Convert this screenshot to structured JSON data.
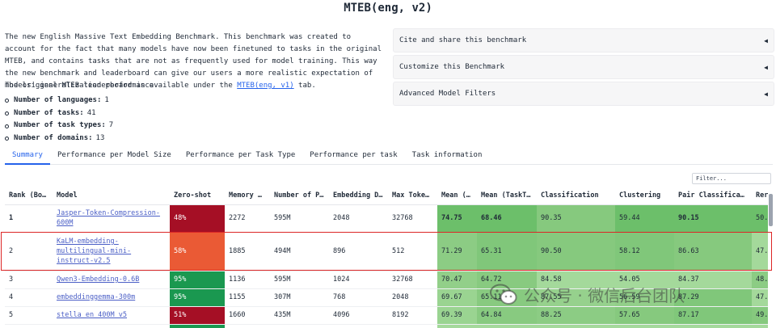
{
  "header": {
    "title": "MTEB(eng, v2)"
  },
  "intro": {
    "text": "The new English Massive Text Embedding Benchmark. This benchmark was created to account for the fact that many models have now been finetuned to tasks in the original MTEB, and contains tasks that are not as frequently used for model training. This way the new benchmark and leaderboard can give our users a more realistic expectation of models' generalization performance.",
    "orig_prefix": "The original MTEB leaderboard is available under the ",
    "orig_link": "MTEB(eng, v1)",
    "orig_suffix": " tab."
  },
  "stats": [
    {
      "label": "Number of languages:",
      "value": "1"
    },
    {
      "label": "Number of tasks:",
      "value": "41"
    },
    {
      "label": "Number of task types:",
      "value": "7"
    },
    {
      "label": "Number of domains:",
      "value": "13"
    }
  ],
  "accordions": [
    {
      "label": "Cite and share this benchmark",
      "arrow": "◀"
    },
    {
      "label": "Customize this Benchmark",
      "arrow": "◀"
    },
    {
      "label": "Advanced Model Filters",
      "arrow": "◀"
    }
  ],
  "tabs": [
    {
      "label": "Summary",
      "active": true
    },
    {
      "label": "Performance per Model Size"
    },
    {
      "label": "Performance per Task Type"
    },
    {
      "label": "Performance per task"
    },
    {
      "label": "Task information"
    }
  ],
  "filter": {
    "placeholder": "Filter..."
  },
  "table": {
    "headers": [
      "Rank (Bor…",
      "Model",
      "Zero-shot",
      "Memory U…",
      "Number of P…",
      "Embedding D…",
      "Max Tokens",
      "Mean (T…",
      "Mean (TaskT…",
      "Classification",
      "Clustering",
      "Pair Classificat…",
      "Rer"
    ],
    "rows": [
      {
        "rank": "1",
        "model": "Jasper-Token-Compression-600M",
        "zero_shot": "48%",
        "zs_color": "#a50f25",
        "memory": "2272",
        "params": "595M",
        "dim": "2048",
        "max_tokens": "32768",
        "mean_task": "74.75",
        "mean_type": "68.46",
        "classification": "90.35",
        "clustering": "59.44",
        "pair": "90.15",
        "rer": "50.",
        "bold": true
      },
      {
        "rank": "2",
        "model": "KaLM-embedding-multilingual-mini-instruct-v2.5",
        "zero_shot": "58%",
        "zs_color": "#ea5a35",
        "memory": "1885",
        "params": "494M",
        "dim": "896",
        "max_tokens": "512",
        "mean_task": "71.29",
        "mean_type": "65.31",
        "classification": "90.50",
        "clustering": "58.12",
        "pair": "86.63",
        "rer": "47."
      },
      {
        "rank": "3",
        "model": "Qwen3-Embedding-0.6B",
        "zero_shot": "95%",
        "zs_color": "#1a9850",
        "memory": "1136",
        "params": "595M",
        "dim": "1024",
        "max_tokens": "32768",
        "mean_task": "70.47",
        "mean_type": "64.72",
        "classification": "84.58",
        "clustering": "54.05",
        "pair": "84.37",
        "rer": "48."
      },
      {
        "rank": "4",
        "model": "embeddinggemma-300m",
        "zero_shot": "95%",
        "zs_color": "#1a9850",
        "memory": "1155",
        "params": "307M",
        "dim": "768",
        "max_tokens": "2048",
        "mean_task": "69.67",
        "mean_type": "65.11",
        "classification": "87.55",
        "clustering": "56.59",
        "pair": "87.29",
        "rer": "47."
      },
      {
        "rank": "5",
        "model": "stella_en_400M_v5",
        "zero_shot": "51%",
        "zs_color": "#a50f25",
        "memory": "1660",
        "params": "435M",
        "dim": "4096",
        "max_tokens": "8192",
        "mean_task": "69.39",
        "mean_type": "64.84",
        "classification": "88.25",
        "clustering": "57.65",
        "pair": "87.17",
        "rer": "49."
      }
    ]
  },
  "watermark": {
    "text": "公众号 · 微信后台团队"
  },
  "colors": {
    "accent": "#2563eb",
    "highlight": "#dc2626",
    "score_green_dark": "#6cbf6a",
    "score_green_mid": "#8ccc84",
    "score_green_light": "#a4d99b"
  }
}
